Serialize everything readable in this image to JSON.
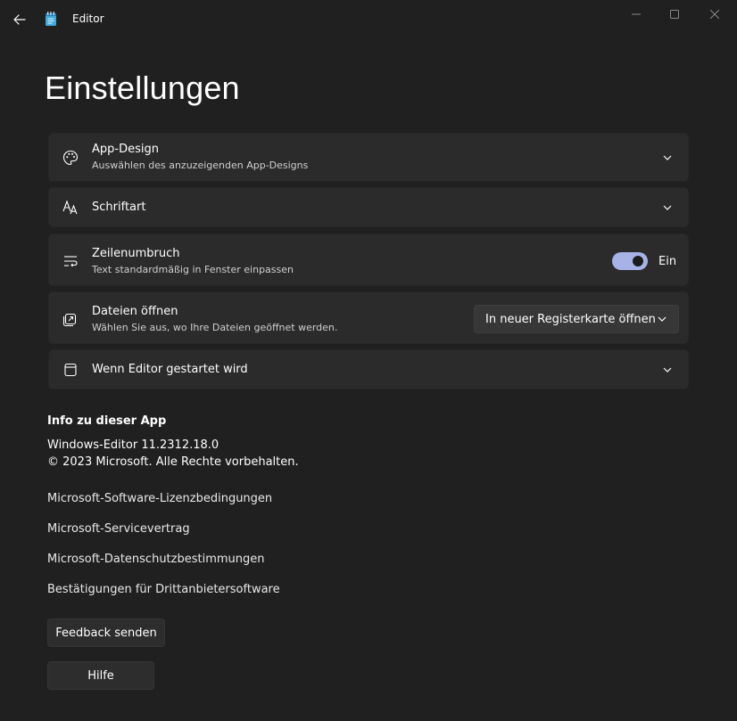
{
  "window": {
    "app_title": "Editor"
  },
  "page": {
    "title": "Einstellungen"
  },
  "settings": {
    "theme": {
      "title": "App-Design",
      "subtitle": "Auswählen des anzuzeigenden App-Designs"
    },
    "font": {
      "title": "Schriftart"
    },
    "wrap": {
      "title": "Zeilenumbruch",
      "subtitle": "Text standardmäßig in Fenster einpassen",
      "state_label": "Ein",
      "enabled": true
    },
    "open_files": {
      "title": "Dateien öffnen",
      "subtitle": "Wählen Sie aus, wo Ihre Dateien geöffnet werden.",
      "selected": "In neuer Registerkarte öffnen"
    },
    "startup": {
      "title": "Wenn Editor gestartet wird"
    }
  },
  "about": {
    "heading": "Info zu dieser App",
    "version": "Windows-Editor 11.2312.18.0",
    "copyright": "© 2023 Microsoft. Alle Rechte vorbehalten.",
    "links": [
      "Microsoft-Software-Lizenzbedingungen",
      "Microsoft-Servicevertrag",
      "Microsoft-Datenschutzbestimmungen",
      "Bestätigungen für Drittanbietersoftware"
    ],
    "feedback_label": "Feedback senden",
    "help_label": "Hilfe"
  },
  "colors": {
    "background": "#202020",
    "card": "#2b2b2b",
    "accent": "#a7b3e6"
  }
}
